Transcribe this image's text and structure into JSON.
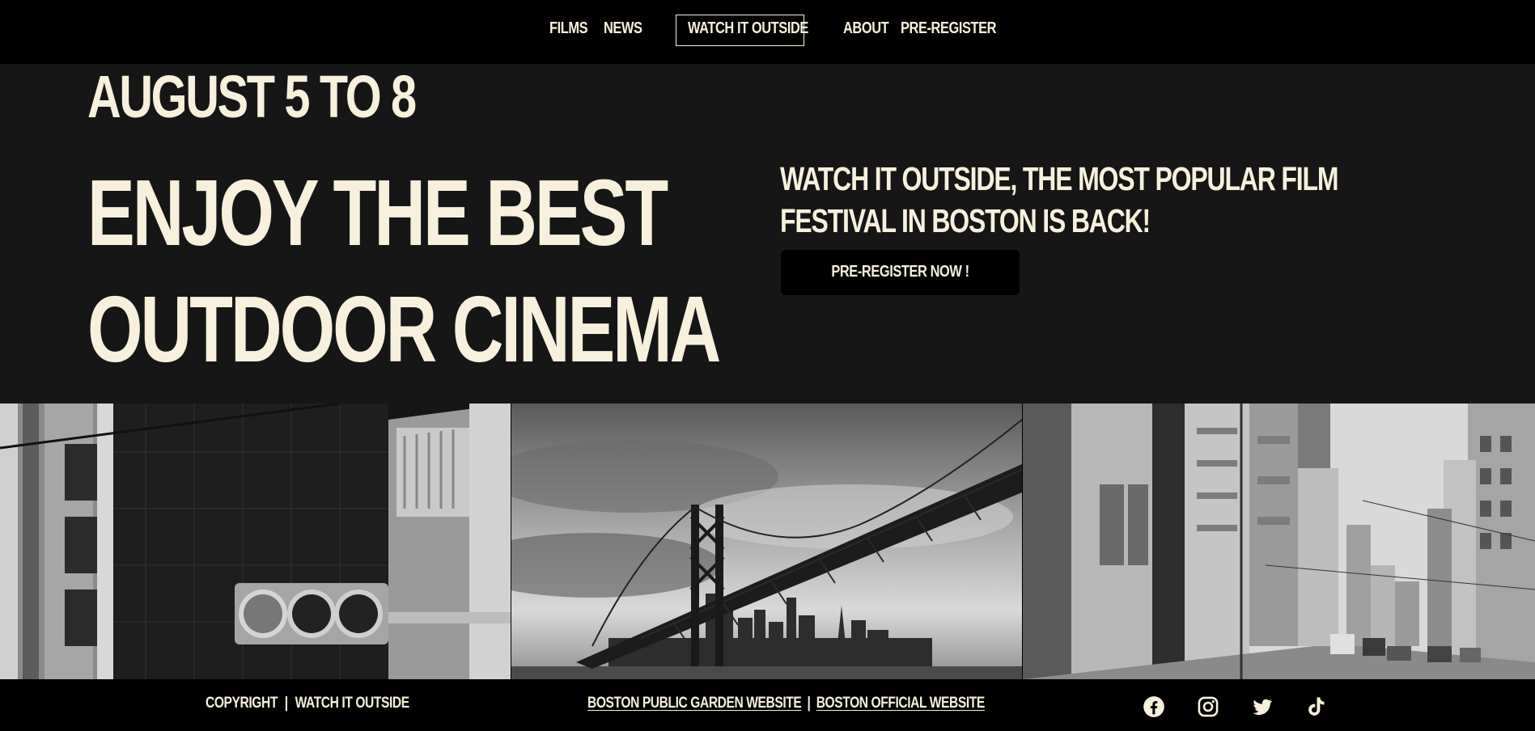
{
  "nav": {
    "films": "FILMS",
    "news": "NEWS",
    "brand": "WATCH IT OUTSIDE",
    "about": "ABOUT",
    "preregister": "PRE-REGISTER"
  },
  "hero": {
    "dates": "AUGUST 5 TO 8",
    "headline_line1": "ENJOY THE BEST",
    "headline_line2": "OUTDOOR CINEMA",
    "tagline": "WATCH IT OUTSIDE, THE MOST POPULAR FILM FESTIVAL IN BOSTON IS BACK!",
    "cta_label": "PRE-REGISTER NOW !"
  },
  "gallery": {
    "images": [
      {
        "subject": "traffic-light-building"
      },
      {
        "subject": "suspension-bridge-skyline"
      },
      {
        "subject": "city-street"
      }
    ]
  },
  "footer": {
    "copyright": "COPYRIGHT",
    "separator1": "|",
    "brand": "WATCH IT OUTSIDE",
    "link1": "BOSTON PUBLIC GARDEN WEBSITE",
    "separator2": "|",
    "link2": "BOSTON OFFICIAL WEBSITE",
    "social": [
      "facebook-icon",
      "instagram-icon",
      "twitter-icon",
      "tiktok-icon"
    ]
  },
  "colors": {
    "cream": "#f6f0dc",
    "nav_bg": "#000000",
    "hero_bg": "#161616"
  }
}
